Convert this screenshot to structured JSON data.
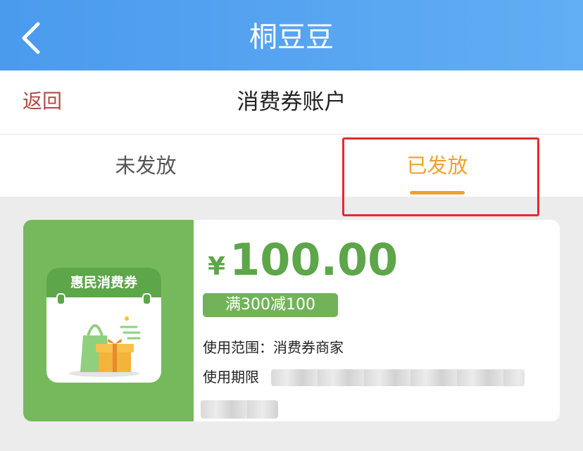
{
  "topbar": {
    "title": "桐豆豆",
    "back_icon": "chevron-left-icon"
  },
  "subheader": {
    "return_label": "返回",
    "page_title": "消费券账户"
  },
  "tabs": [
    {
      "label": "未发放",
      "active": false
    },
    {
      "label": "已发放",
      "active": true
    }
  ],
  "coupon": {
    "badge_title": "惠民消费券",
    "badge_icon": "gift-bag-icon",
    "currency": "¥",
    "amount": "100.00",
    "rule": "满300减100",
    "scope_label": "使用范围：",
    "scope_value": "消费券商家",
    "period_label": "使用期限"
  },
  "colors": {
    "topbar_blue": "#4a9aee",
    "accent_orange": "#f0a030",
    "coupon_green": "#76b95c",
    "highlight_red": "#e32b2b"
  }
}
